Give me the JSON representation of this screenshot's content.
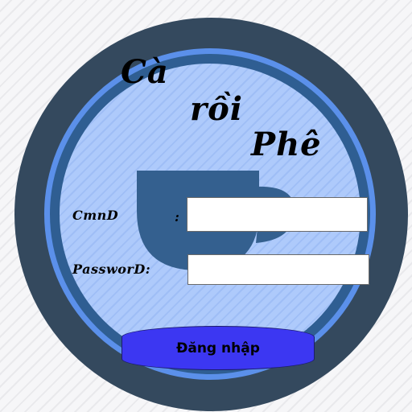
{
  "title": {
    "line1": "Cà",
    "line2": "rồi",
    "line3": "Phê"
  },
  "form": {
    "cmnd_label": "CmnD",
    "cmnd_colon": ":",
    "cmnd_value": "",
    "password_label": "PassworD:",
    "password_value": "",
    "login_label": "Đăng nhập"
  },
  "icons": {
    "background": "coffee-cup-icon"
  },
  "colors": {
    "outer_ring": "#34495e",
    "accent_ring": "#5b90ea",
    "inner_disk": "#a8c6fb",
    "cup": "#34608f",
    "button": "#3c37f2"
  }
}
